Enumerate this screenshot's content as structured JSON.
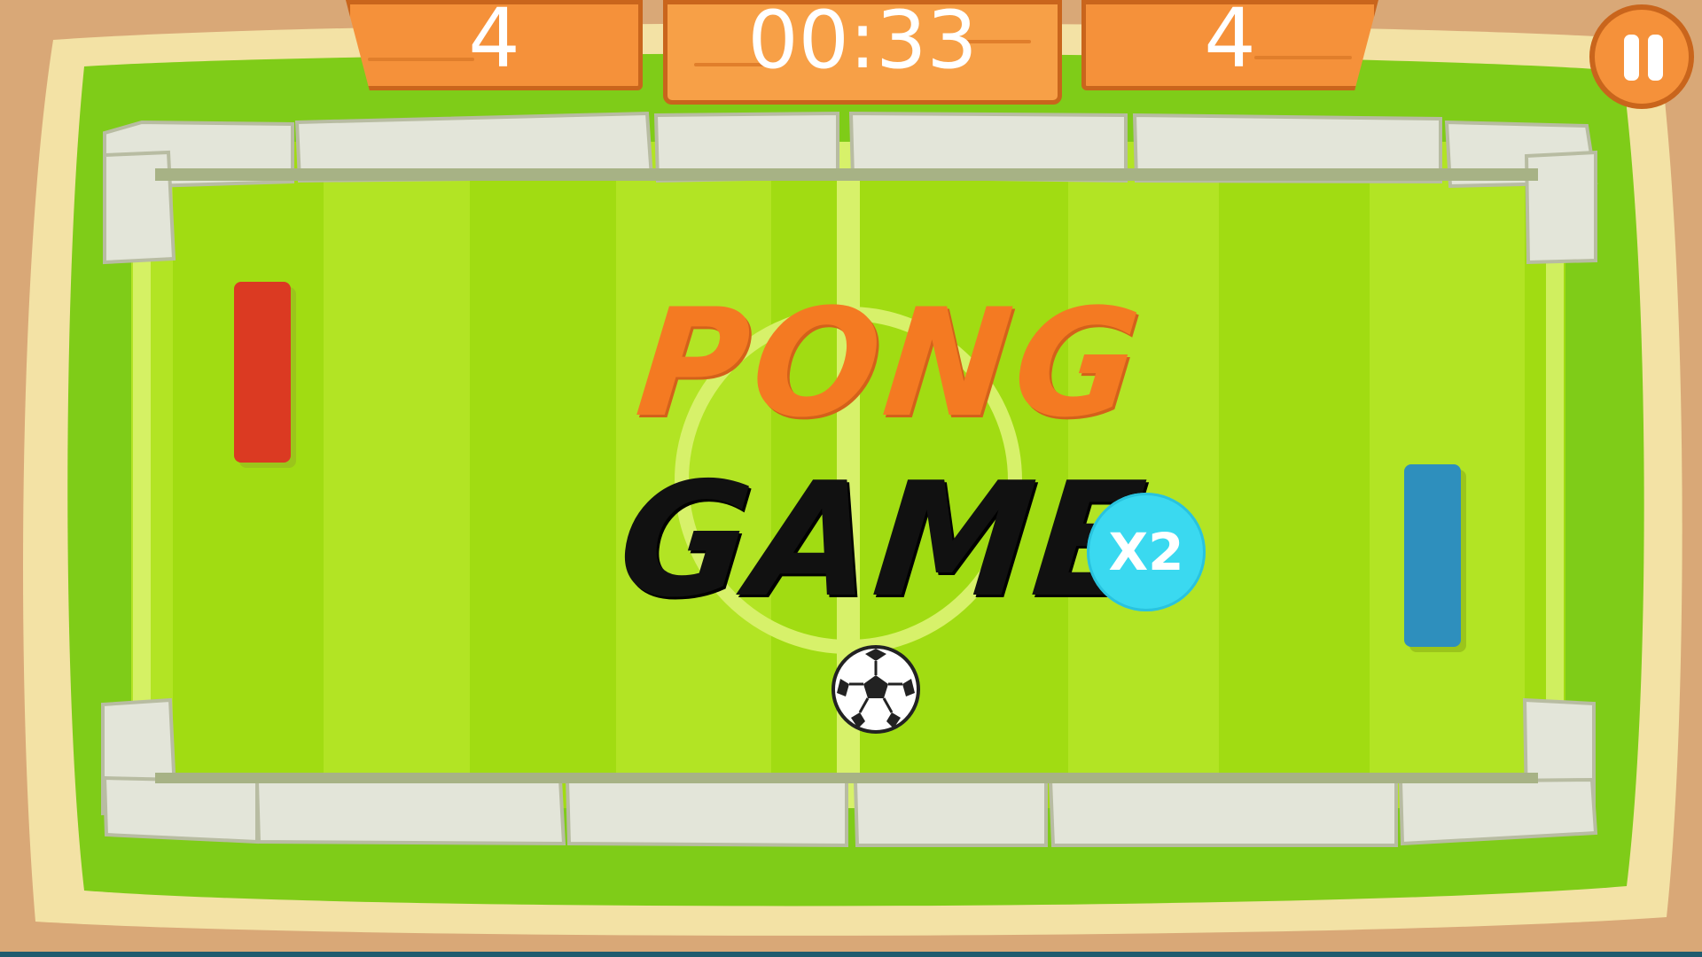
{
  "scoreboard": {
    "left_score": "4",
    "timer": "00:33",
    "right_score": "4"
  },
  "title": {
    "line1": "PONG",
    "line2": "GAME"
  },
  "powerup": {
    "label": "X2",
    "color": "#3ad9f0"
  },
  "players": {
    "left_paddle_color": "#db3a22",
    "right_paddle_color": "#2e8fbd"
  },
  "icons": {
    "pause": "pause-icon",
    "ball": "soccer-ball-icon"
  },
  "colors": {
    "sand": "#d9a877",
    "grass_light": "#b6e82a",
    "grass_dark": "#9ddb0b",
    "wood": "#f5913a",
    "stone": "#e3e5d9"
  }
}
